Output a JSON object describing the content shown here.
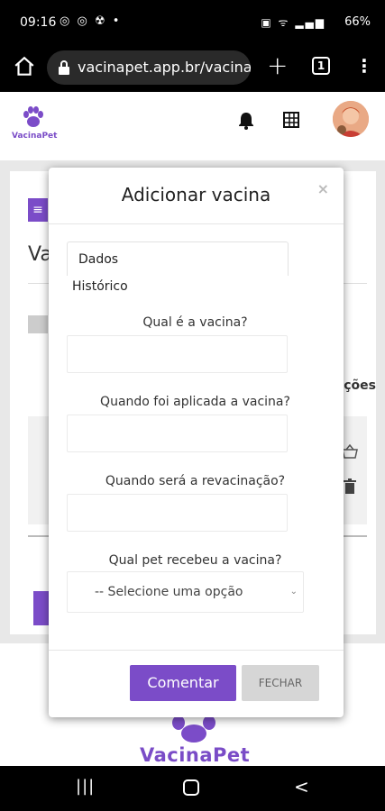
{
  "status_bar": {
    "time": "09:16",
    "notification_icons": "◎ ◎ ☢ •",
    "system_icons": "▣ ᯤ ▂▄▆",
    "battery": "66%"
  },
  "browser": {
    "url": "vacinapet.app.br/vacina",
    "tab_count": "1",
    "plus_label": "+",
    "menu_label": "⋮"
  },
  "app": {
    "logo_text": "VacinaPet",
    "menu_icon": "≡",
    "page_title_fragment": "Va",
    "column_header_fragment": "ções",
    "footer_brand": "VacinaPet"
  },
  "modal": {
    "title": "Adicionar vacina",
    "close_label": "×",
    "tabs": [
      "Dados",
      "Histórico"
    ],
    "fields": [
      {
        "label": "Qual é a vacina?",
        "value": ""
      },
      {
        "label": "Quando foi aplicada a vacina?",
        "value": ""
      },
      {
        "label": "Quando será a revacinação?",
        "value": ""
      }
    ],
    "pet_label": "Qual pet recebeu a vacina?",
    "pet_select": "-- Selecione uma opção",
    "comment_button": "Comentar",
    "close_button": "FECHAR"
  },
  "nav": {
    "recents": "|||",
    "back": "<"
  },
  "colors": {
    "brand_purple": "#7b4cc8",
    "overlay_gray": "#e8e8e8"
  }
}
